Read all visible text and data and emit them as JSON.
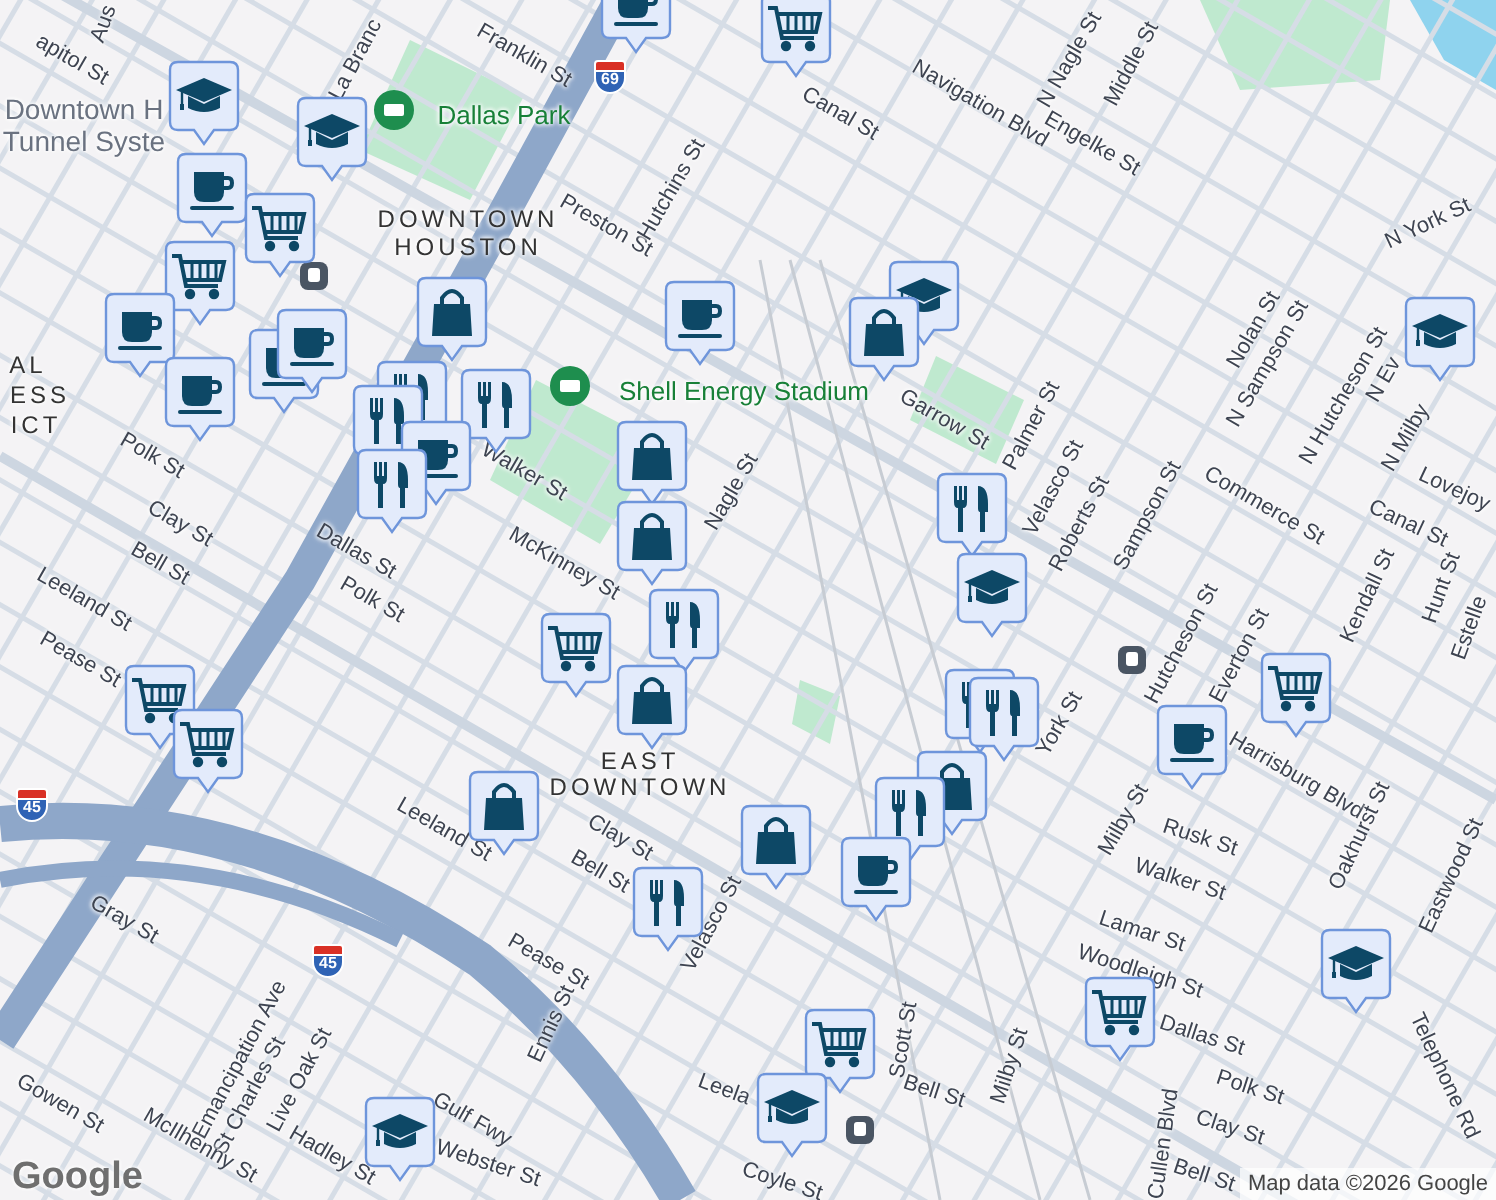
{
  "map": {
    "labels": [
      {
        "text": "apitol St",
        "kind": "street"
      },
      {
        "text": "Aus",
        "kind": "street"
      },
      {
        "text": "La Branc",
        "kind": "street"
      },
      {
        "text": "Franklin St",
        "kind": "street"
      },
      {
        "text": "Downtown H",
        "kind": "poi"
      },
      {
        "text": "Tunnel Syste",
        "kind": "poi"
      },
      {
        "text": "Dallas Park",
        "kind": "park"
      },
      {
        "text": "Preston St",
        "kind": "street"
      },
      {
        "text": "Hutchins St",
        "kind": "street"
      },
      {
        "text": "DOWNTOWN",
        "kind": "area"
      },
      {
        "text": "HOUSTON",
        "kind": "area"
      },
      {
        "text": "Shell Energy Stadium",
        "kind": "park"
      },
      {
        "text": "Canal St",
        "kind": "street"
      },
      {
        "text": "Navigation Blvd",
        "kind": "street"
      },
      {
        "text": "N Nagle St",
        "kind": "street"
      },
      {
        "text": "Middle St",
        "kind": "street"
      },
      {
        "text": "Engelke St",
        "kind": "street"
      },
      {
        "text": "N York St",
        "kind": "street"
      },
      {
        "text": "Nolan St",
        "kind": "street"
      },
      {
        "text": "N Sampson St",
        "kind": "street"
      },
      {
        "text": "N Hutcheson St",
        "kind": "street"
      },
      {
        "text": "N Ev",
        "kind": "street"
      },
      {
        "text": "N Milby",
        "kind": "street"
      },
      {
        "text": "Lovejoy",
        "kind": "street"
      },
      {
        "text": "Garrow St",
        "kind": "street"
      },
      {
        "text": "Palmer St",
        "kind": "street"
      },
      {
        "text": "Velasco St",
        "kind": "street"
      },
      {
        "text": "Roberts St",
        "kind": "street"
      },
      {
        "text": "Sampson St",
        "kind": "street"
      },
      {
        "text": "Commerce St",
        "kind": "street"
      },
      {
        "text": "Canal St",
        "kind": "street"
      },
      {
        "text": "Kendall St",
        "kind": "street"
      },
      {
        "text": "Hunt St",
        "kind": "street"
      },
      {
        "text": "Estelle",
        "kind": "street"
      },
      {
        "text": "Hutcheson St",
        "kind": "street"
      },
      {
        "text": "Everton St",
        "kind": "street"
      },
      {
        "text": "Harrisburg Blvd",
        "kind": "street"
      },
      {
        "text": "York St",
        "kind": "street"
      },
      {
        "text": "Milby St",
        "kind": "street"
      },
      {
        "text": "Rusk St",
        "kind": "street"
      },
      {
        "text": "Walker St",
        "kind": "street"
      },
      {
        "text": "Lamar St",
        "kind": "street"
      },
      {
        "text": "Woodleigh St",
        "kind": "street"
      },
      {
        "text": "Dallas St",
        "kind": "street"
      },
      {
        "text": "Oakhurst St",
        "kind": "street"
      },
      {
        "text": "Eastwood St",
        "kind": "street"
      },
      {
        "text": "Telephone Rd",
        "kind": "street"
      },
      {
        "text": "Polk St",
        "kind": "street"
      },
      {
        "text": "Clay St",
        "kind": "street"
      },
      {
        "text": "Bell St",
        "kind": "street"
      },
      {
        "text": "Cullen Blvd",
        "kind": "street"
      },
      {
        "text": "Bell St",
        "kind": "street"
      },
      {
        "text": "Milby St",
        "kind": "street"
      },
      {
        "text": "Scott St",
        "kind": "street"
      },
      {
        "text": "Coyle St",
        "kind": "street"
      },
      {
        "text": "Leela",
        "kind": "street"
      },
      {
        "text": "Velasco St",
        "kind": "street"
      },
      {
        "text": "Bell St",
        "kind": "street"
      },
      {
        "text": "Clay St",
        "kind": "street"
      },
      {
        "text": "Pease St",
        "kind": "street"
      },
      {
        "text": "Ennis St",
        "kind": "street"
      },
      {
        "text": "EAST",
        "kind": "area"
      },
      {
        "text": "DOWNTOWN",
        "kind": "area"
      },
      {
        "text": "Leeland St",
        "kind": "street"
      },
      {
        "text": "Gray St",
        "kind": "street"
      },
      {
        "text": "Emancipation Ave",
        "kind": "street"
      },
      {
        "text": "St Charles St",
        "kind": "street"
      },
      {
        "text": "Live Oak St",
        "kind": "street"
      },
      {
        "text": "Gulf Fwy",
        "kind": "street"
      },
      {
        "text": "McIlhenny St",
        "kind": "street"
      },
      {
        "text": "Hadley St",
        "kind": "street"
      },
      {
        "text": "Webster St",
        "kind": "street"
      },
      {
        "text": "Gowen St",
        "kind": "street"
      },
      {
        "text": "Pease St",
        "kind": "street"
      },
      {
        "text": "Leeland St",
        "kind": "street"
      },
      {
        "text": "Bell St",
        "kind": "street"
      },
      {
        "text": "Clay St",
        "kind": "street"
      },
      {
        "text": "Polk St",
        "kind": "street"
      },
      {
        "text": "Polk St",
        "kind": "street"
      },
      {
        "text": "Dallas St",
        "kind": "street"
      },
      {
        "text": "Walker St",
        "kind": "street"
      },
      {
        "text": "McKinney St",
        "kind": "street"
      },
      {
        "text": "Nagle St",
        "kind": "street"
      },
      {
        "text": "AL",
        "kind": "area"
      },
      {
        "text": "ESS",
        "kind": "area"
      },
      {
        "text": "ICT",
        "kind": "area"
      }
    ],
    "highway_shields": [
      "69",
      "45",
      "45"
    ],
    "markers": [
      {
        "kind": "cafe"
      },
      {
        "kind": "grocery"
      },
      {
        "kind": "school"
      },
      {
        "kind": "school"
      },
      {
        "kind": "cafe"
      },
      {
        "kind": "grocery"
      },
      {
        "kind": "grocery"
      },
      {
        "kind": "cafe"
      },
      {
        "kind": "cafe"
      },
      {
        "kind": "cafe"
      },
      {
        "kind": "cafe"
      },
      {
        "kind": "shop"
      },
      {
        "kind": "restaurant"
      },
      {
        "kind": "restaurant"
      },
      {
        "kind": "restaurant"
      },
      {
        "kind": "cafe"
      },
      {
        "kind": "restaurant"
      },
      {
        "kind": "cafe"
      },
      {
        "kind": "shop"
      },
      {
        "kind": "shop"
      },
      {
        "kind": "restaurant"
      },
      {
        "kind": "grocery"
      },
      {
        "kind": "shop"
      },
      {
        "kind": "grocery"
      },
      {
        "kind": "grocery"
      },
      {
        "kind": "shop"
      },
      {
        "kind": "restaurant"
      },
      {
        "kind": "shop"
      },
      {
        "kind": "school"
      },
      {
        "kind": "shop"
      },
      {
        "kind": "restaurant"
      },
      {
        "kind": "school"
      },
      {
        "kind": "restaurant"
      },
      {
        "kind": "restaurant"
      },
      {
        "kind": "shop"
      },
      {
        "kind": "restaurant"
      },
      {
        "kind": "cafe"
      },
      {
        "kind": "cafe"
      },
      {
        "kind": "grocery"
      },
      {
        "kind": "school"
      },
      {
        "kind": "school"
      },
      {
        "kind": "grocery"
      },
      {
        "kind": "grocery"
      },
      {
        "kind": "school"
      },
      {
        "kind": "school"
      }
    ]
  },
  "attribution": {
    "logo": "Google",
    "text": "Map data ©2026 Google"
  }
}
